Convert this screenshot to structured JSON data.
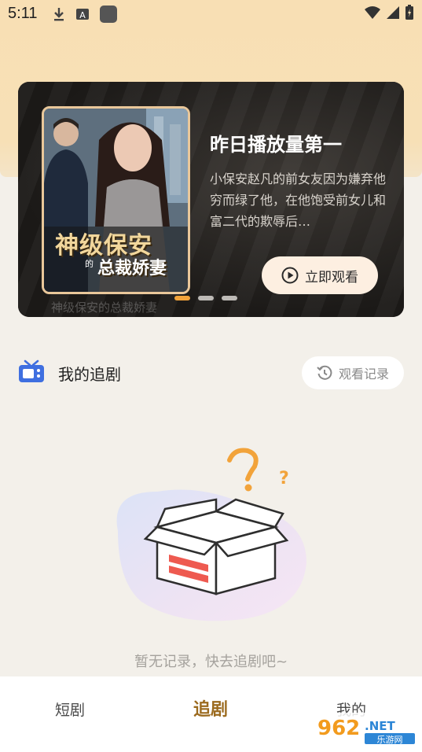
{
  "status_bar": {
    "time": "5:11"
  },
  "banner": {
    "heading": "昨日播放量第一",
    "description": "小保安赵凡的前女友因为嫌弃他穷而绿了他，在他饱受前女儿和富二代的欺辱后…",
    "watch_button": "立即观看",
    "poster_title_top": "神级保安",
    "poster_title_small": "的",
    "poster_title_bottom": "总裁娇妻",
    "faded_caption": "神级保安的总裁娇妻",
    "page_count": 3,
    "active_index": 0
  },
  "section": {
    "title": "我的追剧",
    "history_button": "观看记录"
  },
  "empty_state": {
    "message": "暂无记录，快去追剧吧~"
  },
  "bottom_nav": {
    "items": [
      {
        "label": "短剧"
      },
      {
        "label": "追剧"
      },
      {
        "label": "我的"
      }
    ],
    "active_index": 1
  },
  "watermark": {
    "brand_top": "962",
    "brand_suffix": ".NET",
    "brand_bottom": "乐游网"
  },
  "colors": {
    "accent": "#F2A33A",
    "active_nav": "#9B6A1E",
    "top_bg": "#F8DFB4",
    "page_bg": "#F3F0EA"
  }
}
